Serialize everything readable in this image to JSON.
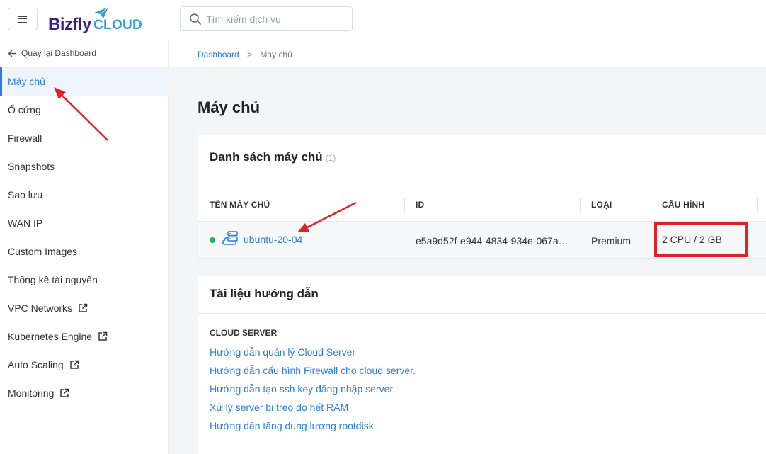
{
  "header": {
    "logo_main": "Bizfly",
    "logo_sub": "CLOUD",
    "search_placeholder": "Tìm kiếm dịch vụ"
  },
  "sidebar": {
    "back_label": "Quay lại Dashboard",
    "items": [
      {
        "label": "Máy chủ",
        "active": true
      },
      {
        "label": "Ổ cứng"
      },
      {
        "label": "Firewall"
      },
      {
        "label": "Snapshots"
      },
      {
        "label": "Sao lưu"
      },
      {
        "label": "WAN IP"
      },
      {
        "label": "Custom Images"
      },
      {
        "label": "Thống kê tài nguyên"
      },
      {
        "label": "VPC Networks",
        "external": true
      },
      {
        "label": "Kubernetes Engine",
        "external": true
      },
      {
        "label": "Auto Scaling",
        "external": true
      },
      {
        "label": "Monitoring",
        "external": true
      }
    ]
  },
  "breadcrumb": {
    "root": "Dashboard",
    "separator": ">",
    "current": "Máy chủ"
  },
  "page": {
    "title": "Máy chủ"
  },
  "server_list": {
    "title": "Danh sách máy chủ",
    "count": "(1)",
    "columns": [
      "TÊN MÁY CHỦ",
      "ID",
      "LOẠI",
      "CẤU HÌNH"
    ],
    "rows": [
      {
        "status": "running",
        "status_color": "#22b14c",
        "name": "ubuntu-20-04",
        "id": "e5a9d52f-e944-4834-934e-067a…",
        "type": "Premium",
        "spec": "2 CPU / 2 GB"
      }
    ]
  },
  "docs": {
    "title": "Tài liệu hướng dẫn",
    "section": "CLOUD SERVER",
    "links": [
      "Hướng dẫn quản lý Cloud Server",
      "Hướng dẫn cấu hình Firewall cho cloud server.",
      "Hướng dẫn tạo ssh key đăng nhập server",
      "Xử lý server bị treo do hết RAM",
      "Hướng dẫn tăng dung lượng rootdisk"
    ]
  },
  "colors": {
    "accent": "#2d7be5",
    "brand_purple": "#3a1f7c",
    "brand_blue": "#2f9be8",
    "annotation_red": "#e32026"
  }
}
